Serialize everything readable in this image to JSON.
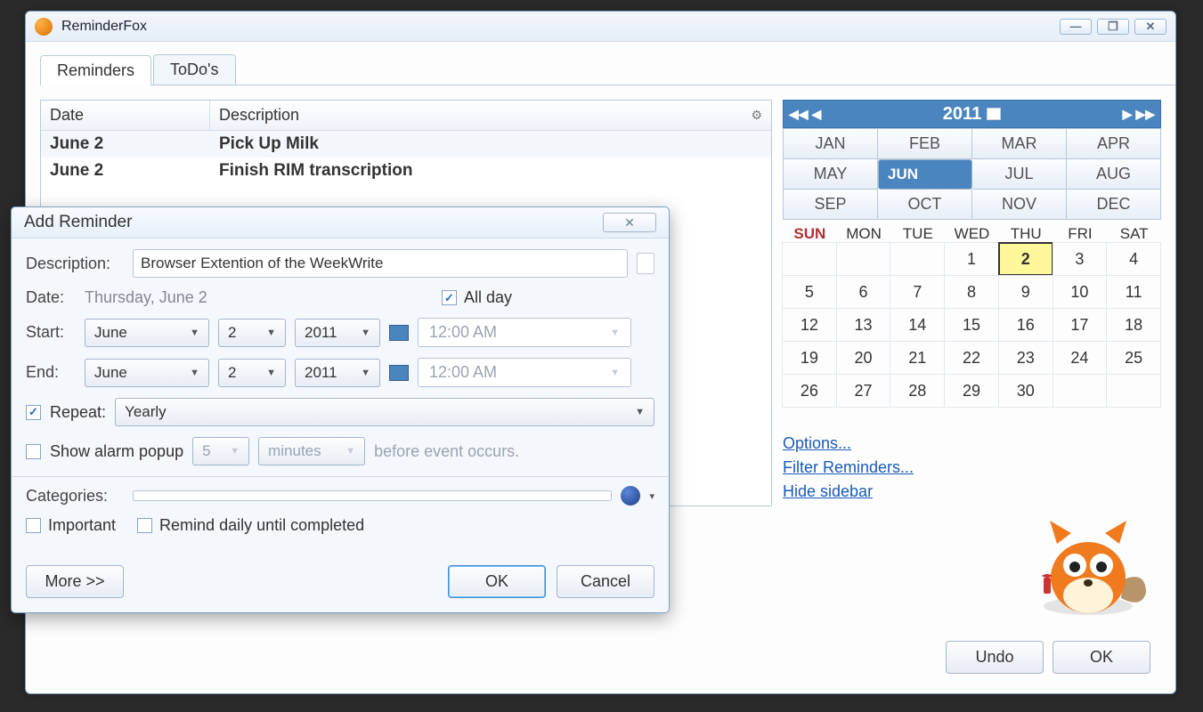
{
  "window": {
    "title": "ReminderFox",
    "min": "—",
    "max": "❐",
    "close": "✕"
  },
  "tabs": {
    "reminders": "Reminders",
    "todos": "ToDo's"
  },
  "list": {
    "header_date": "Date",
    "header_desc": "Description",
    "rows": [
      {
        "date": "June 2",
        "desc": "Pick Up Milk"
      },
      {
        "date": "June 2",
        "desc": "Finish RIM transcription"
      }
    ]
  },
  "calendar": {
    "year": "2011",
    "nav_prev2": "◀◀",
    "nav_prev": "◀",
    "nav_next": "▶",
    "nav_next2": "▶▶",
    "months": [
      "JAN",
      "FEB",
      "MAR",
      "APR",
      "MAY",
      "JUN",
      "JUL",
      "AUG",
      "SEP",
      "OCT",
      "NOV",
      "DEC"
    ],
    "selected_month": "JUN",
    "dow": [
      "SUN",
      "MON",
      "TUE",
      "WED",
      "THU",
      "FRI",
      "SAT"
    ],
    "weeks": [
      [
        "",
        "",
        "",
        "1",
        "2",
        "3",
        "4"
      ],
      [
        "5",
        "6",
        "7",
        "8",
        "9",
        "10",
        "11"
      ],
      [
        "12",
        "13",
        "14",
        "15",
        "16",
        "17",
        "18"
      ],
      [
        "19",
        "20",
        "21",
        "22",
        "23",
        "24",
        "25"
      ],
      [
        "26",
        "27",
        "28",
        "29",
        "30",
        "",
        ""
      ]
    ],
    "today": "2",
    "links": {
      "options": "Options...",
      "filter": "Filter Reminders...",
      "hide": "Hide sidebar"
    }
  },
  "main_buttons": {
    "undo": "Undo",
    "ok": "OK"
  },
  "modal": {
    "title": "Add Reminder",
    "close": "✕",
    "desc_label": "Description:",
    "desc_value": "Browser Extention of the WeekWrite",
    "date_label": "Date:",
    "date_display": "Thursday, June 2",
    "allday_label": "All day",
    "allday_checked": "✓",
    "start_label": "Start:",
    "end_label": "End:",
    "month_sel": "June",
    "day_sel": "2",
    "year_sel": "2011",
    "time_sel": "12:00 AM",
    "repeat_checked": "✓",
    "repeat_label": "Repeat:",
    "repeat_value": "Yearly",
    "alarm_label": "Show alarm popup",
    "alarm_num": "5",
    "alarm_unit": "minutes",
    "alarm_suffix": "before event occurs.",
    "cat_label": "Categories:",
    "important_label": "Important",
    "remind_daily_label": "Remind daily until completed",
    "more": "More >>",
    "ok": "OK",
    "cancel": "Cancel"
  }
}
